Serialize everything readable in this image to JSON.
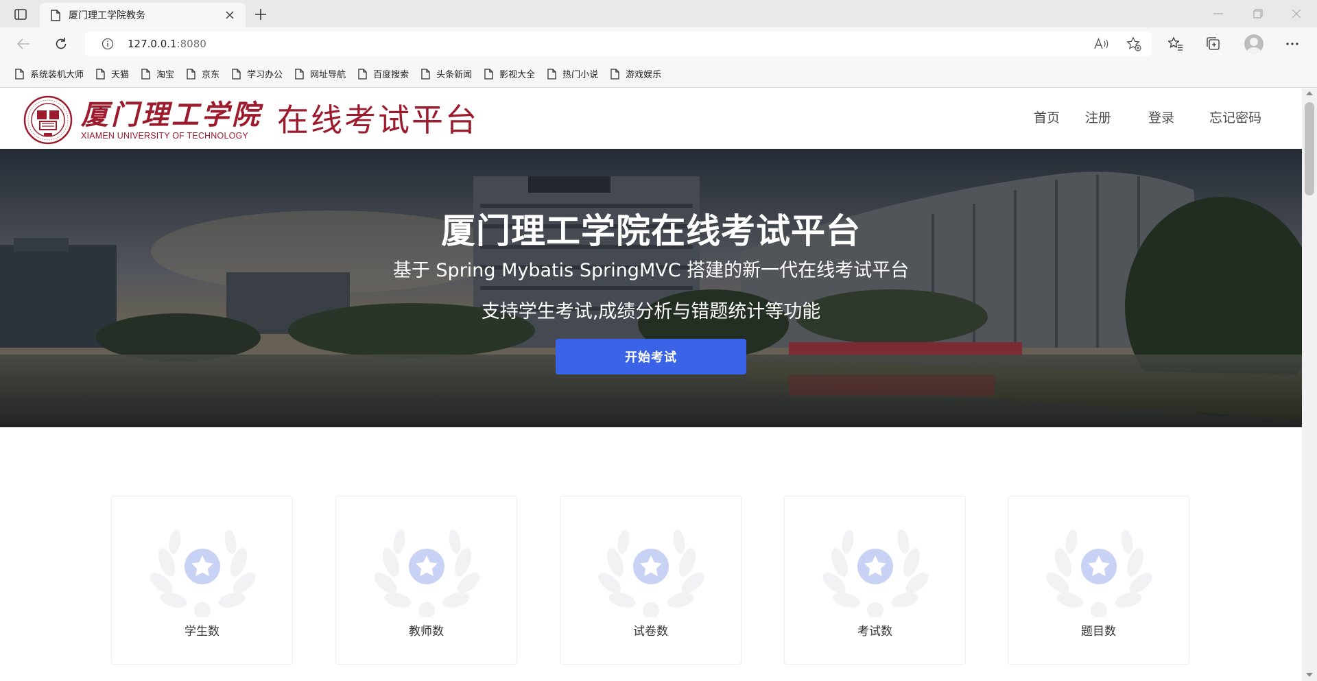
{
  "browser": {
    "tab_title": "厦门理工学院教务",
    "url_host": "127.0.0.1",
    "url_port": ":8080",
    "bookmarks": [
      "系统装机大师",
      "天猫",
      "淘宝",
      "京东",
      "学习办公",
      "网址导航",
      "百度搜索",
      "头条新闻",
      "影视大全",
      "热门小说",
      "游戏娱乐"
    ]
  },
  "site": {
    "logo_cn": "厦门理工学院",
    "logo_en": "XIAMEN UNIVERSITY OF TECHNOLOGY",
    "logo_platform": "在线考试平台",
    "nav": [
      "首页",
      "注册",
      "登录",
      "忘记密码"
    ]
  },
  "hero": {
    "title": "厦门理工学院在线考试平台",
    "subtitle": "基于 Spring Mybatis SpringMVC 搭建的新一代在线考试平台",
    "subtitle2": "支持学生考试,成绩分析与错题统计等功能",
    "button": "开始考试"
  },
  "stats": [
    "学生数",
    "教师数",
    "试卷数",
    "考试数",
    "题目数"
  ],
  "colors": {
    "brand": "#9c1b2d",
    "button": "#3b63e8",
    "badge": "#c8d2f5"
  }
}
